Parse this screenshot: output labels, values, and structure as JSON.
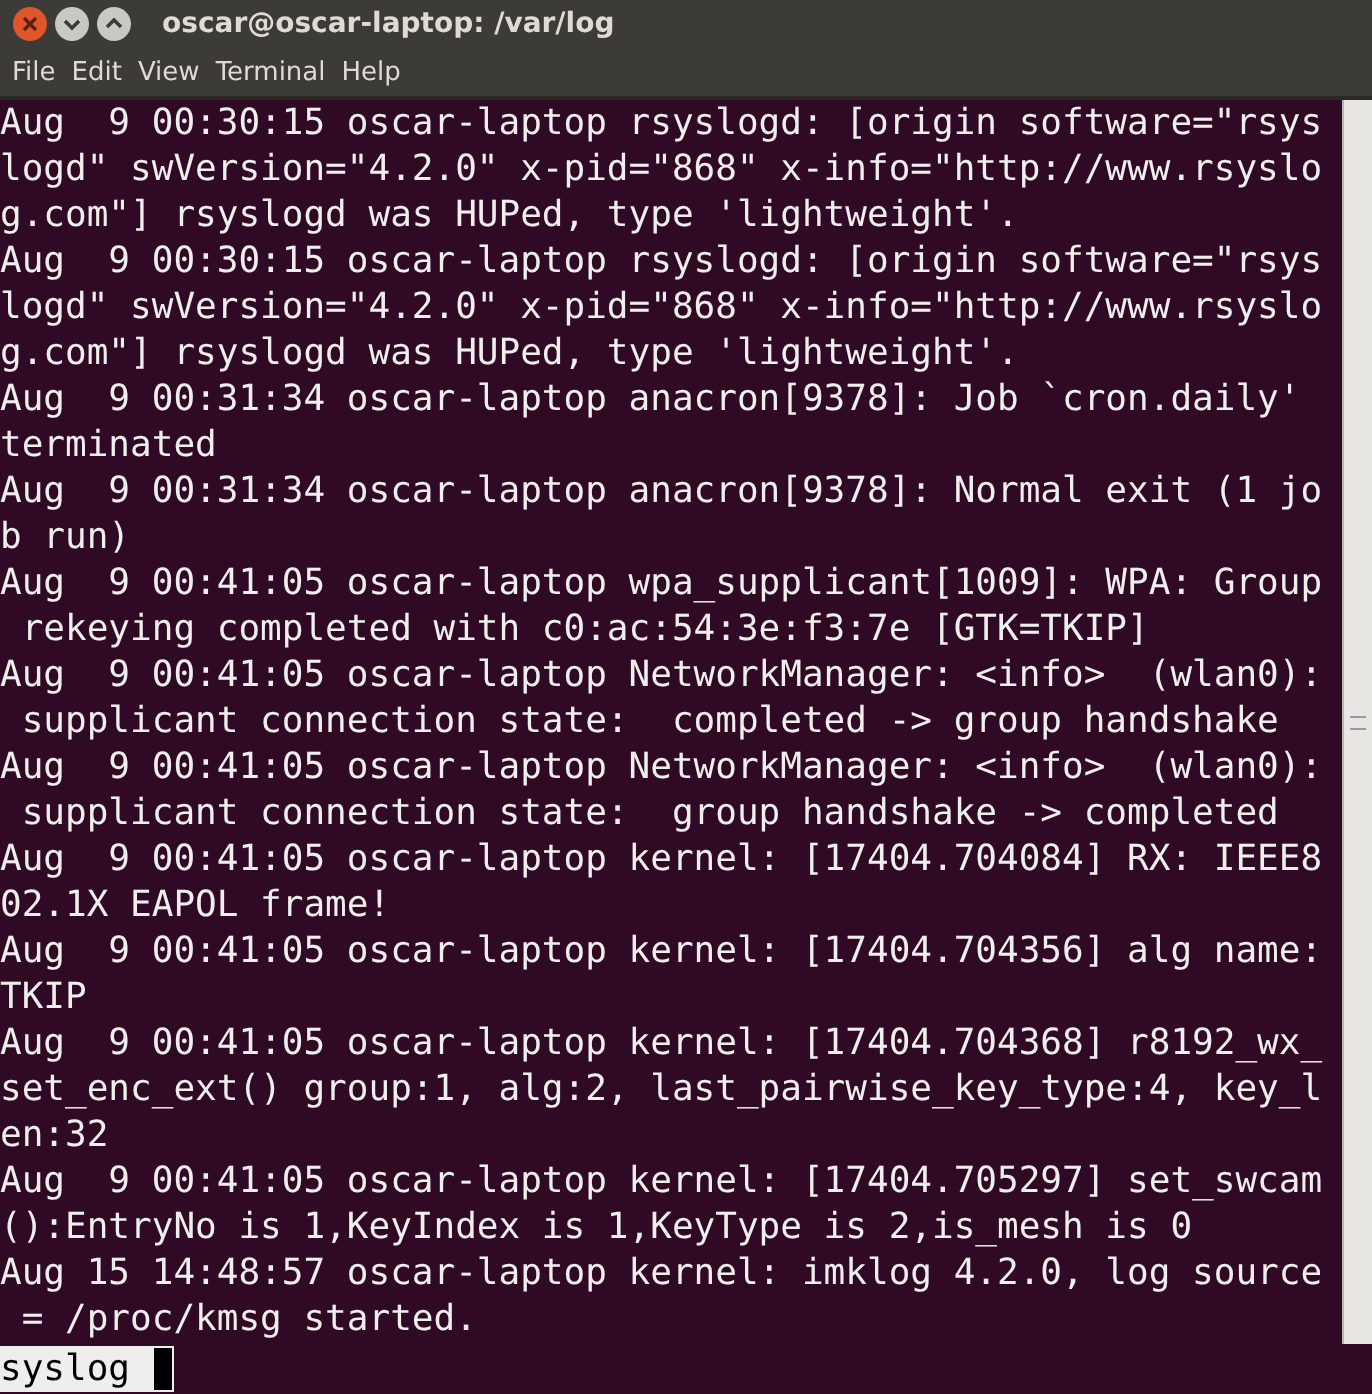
{
  "window": {
    "title": "oscar@oscar-laptop: /var/log"
  },
  "menu": [
    "File",
    "Edit",
    "View",
    "Terminal",
    "Help"
  ],
  "terminal": {
    "lines": [
      "Aug  9 00:30:15 oscar-laptop rsyslogd: [origin software=\"rsys",
      "logd\" swVersion=\"4.2.0\" x-pid=\"868\" x-info=\"http://www.rsyslo",
      "g.com\"] rsyslogd was HUPed, type 'lightweight'.",
      "Aug  9 00:30:15 oscar-laptop rsyslogd: [origin software=\"rsys",
      "logd\" swVersion=\"4.2.0\" x-pid=\"868\" x-info=\"http://www.rsyslo",
      "g.com\"] rsyslogd was HUPed, type 'lightweight'.",
      "Aug  9 00:31:34 oscar-laptop anacron[9378]: Job `cron.daily'",
      "terminated",
      "Aug  9 00:31:34 oscar-laptop anacron[9378]: Normal exit (1 jo",
      "b run)",
      "Aug  9 00:41:05 oscar-laptop wpa_supplicant[1009]: WPA: Group",
      " rekeying completed with c0:ac:54:3e:f3:7e [GTK=TKIP]",
      "Aug  9 00:41:05 oscar-laptop NetworkManager: <info>  (wlan0):",
      " supplicant connection state:  completed -> group handshake",
      "Aug  9 00:41:05 oscar-laptop NetworkManager: <info>  (wlan0):",
      " supplicant connection state:  group handshake -> completed",
      "Aug  9 00:41:05 oscar-laptop kernel: [17404.704084] RX: IEEE8",
      "02.1X EAPOL frame!",
      "Aug  9 00:41:05 oscar-laptop kernel: [17404.704356] alg name:",
      "TKIP",
      "Aug  9 00:41:05 oscar-laptop kernel: [17404.704368] r8192_wx_",
      "set_enc_ext() group:1, alg:2, last_pairwise_key_type:4, key_l",
      "en:32",
      "Aug  9 00:41:05 oscar-laptop kernel: [17404.705297] set_swcam",
      "():EntryNo is 1,KeyIndex is 1,KeyType is 2,is_mesh is 0",
      "Aug 15 14:48:57 oscar-laptop kernel: imklog 4.2.0, log source",
      " = /proc/kmsg started."
    ],
    "prompt": "syslog"
  }
}
